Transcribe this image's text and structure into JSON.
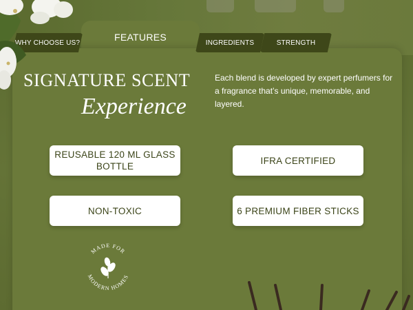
{
  "tabs": {
    "why": "WHY CHOOSE US?",
    "features": "FEATURES",
    "ingredients": "INGREDIENTS",
    "strength": "STRENGTH"
  },
  "heading": {
    "line1": "SIGNATURE SCENT",
    "line2": "Experience"
  },
  "description": "Each blend is developed by expert perfumers for a fragrance that’s unique, memorable, and layered.",
  "features": [
    "REUSABLE 120 ML GLASS BOTTLE",
    "IFRA CERTIFIED",
    "NON-TOXIC",
    "6 PREMIUM FIBER STICKS"
  ],
  "badge": {
    "top_text": "MADE FOR",
    "bottom_text": "MODERN HOMES",
    "icon": "leaf-sprig-icon"
  },
  "colors": {
    "background": "#5f6e33",
    "panel": "#6b7a3a",
    "tab_dark": "#3e4719",
    "card_text": "#3b4418"
  }
}
